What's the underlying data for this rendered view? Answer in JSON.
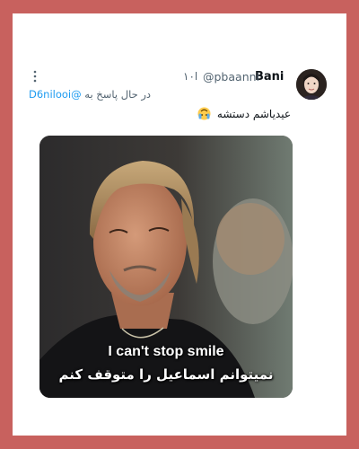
{
  "tweet": {
    "author": {
      "display_name": "Bani",
      "handle": "@pbaanni",
      "time": "۱۰ا"
    },
    "reply_to": {
      "prefix": "در حال پاسخ به",
      "handle": "@D6nilooi"
    },
    "text": "عیدیاشم دستشه",
    "emoji": "upside-down-crying-face",
    "media": {
      "subtitle_en": "I can't stop smile",
      "subtitle_fa": "نمیتوانم اسماعیل را متوقف کنم"
    }
  },
  "colors": {
    "frame_background": "#c8615e",
    "card_background": "#ffffff",
    "primary_text": "#0f1419",
    "secondary_text": "#536471",
    "link": "#1d9bf0"
  }
}
